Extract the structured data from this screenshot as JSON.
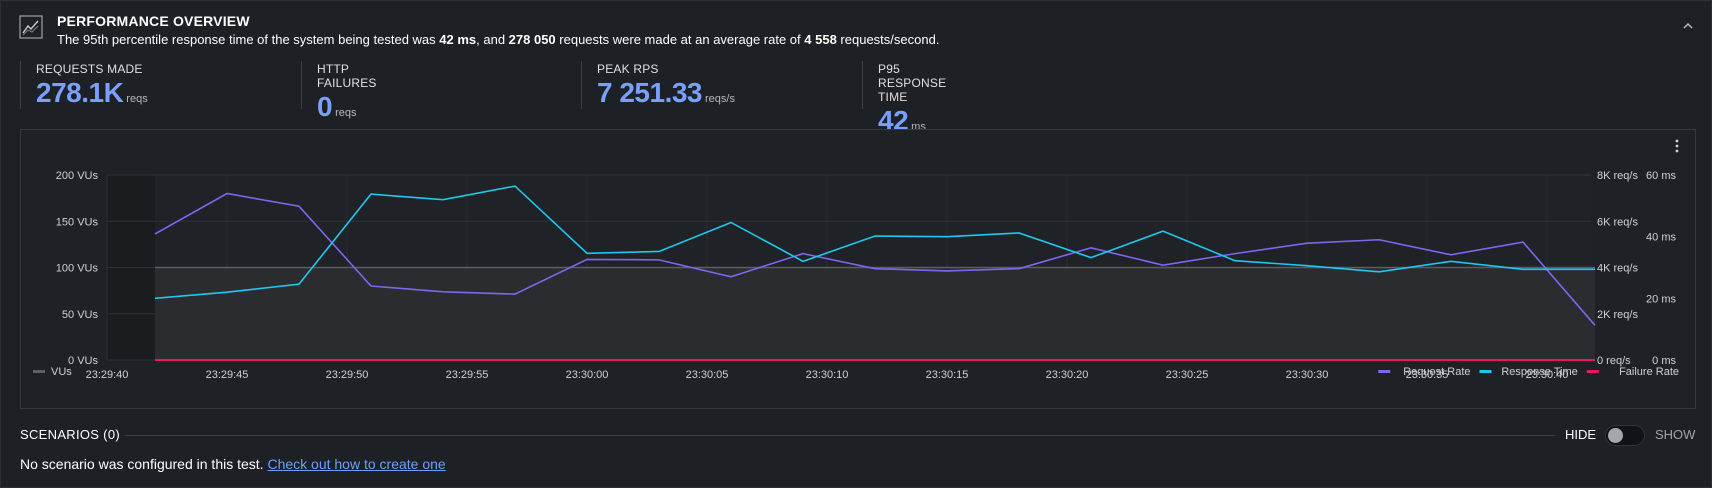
{
  "header": {
    "title": "PERFORMANCE OVERVIEW",
    "desc_1": "The 95th percentile response time of the system being tested was ",
    "desc_p95": "42 ms",
    "desc_2": ", and ",
    "desc_requests": "278 050",
    "desc_3": " requests were made at an average rate of ",
    "desc_rate": "4 558",
    "desc_4": " requests/second."
  },
  "stats": [
    {
      "label": "REQUESTS MADE",
      "value": "278.1K",
      "unit": "reqs"
    },
    {
      "label": "HTTP FAILURES",
      "value": "0",
      "unit": "reqs"
    },
    {
      "label": "PEAK RPS",
      "value": "7 251.33",
      "unit": "reqs/s"
    },
    {
      "label": "P95 RESPONSE TIME",
      "value": "42",
      "unit": "ms"
    }
  ],
  "chart_data": {
    "type": "line",
    "x_ticks": [
      "23:29:40",
      "23:29:45",
      "23:29:50",
      "23:29:55",
      "23:30:00",
      "23:30:05",
      "23:30:10",
      "23:30:15",
      "23:30:20",
      "23:30:25",
      "23:30:30",
      "23:30:35",
      "23:30:40"
    ],
    "y_left_ticks": [
      "0 VUs",
      "50 VUs",
      "100 VUs",
      "150 VUs",
      "200 VUs"
    ],
    "y_left_lim": [
      0,
      200
    ],
    "y_right1_ticks": [
      "0 req/s",
      "2K req/s",
      "4K req/s",
      "6K req/s",
      "8K req/s"
    ],
    "y_right1_lim": [
      0,
      8000
    ],
    "y_right2_ticks": [
      "0 ms",
      "20 ms",
      "40 ms",
      "60 ms"
    ],
    "y_right2_lim": [
      0,
      60
    ],
    "x_times": [
      "23:29:42",
      "23:29:45",
      "23:29:48",
      "23:29:51",
      "23:29:54",
      "23:29:57",
      "23:30:00",
      "23:30:03",
      "23:30:06",
      "23:30:09",
      "23:30:12",
      "23:30:15",
      "23:30:18",
      "23:30:21",
      "23:30:24",
      "23:30:27",
      "23:30:30",
      "23:30:33",
      "23:30:36",
      "23:30:39",
      "23:30:42"
    ],
    "grid": true,
    "legend_left": [
      {
        "name": "VUs",
        "color": "#5c5f63"
      }
    ],
    "legend_right": [
      {
        "name": "Request Rate",
        "color": "#7b68ee"
      },
      {
        "name": "Response Time",
        "color": "#1ec8ef"
      },
      {
        "name": "Failure Rate",
        "color": "#e8185a"
      }
    ],
    "series": [
      {
        "name": "VUs",
        "axis": "left",
        "values": [
          100,
          100,
          100,
          100,
          100,
          100,
          100,
          100,
          100,
          100,
          100,
          100,
          100,
          100,
          100,
          100,
          100,
          100,
          100,
          100,
          100
        ]
      },
      {
        "name": "Request Rate",
        "axis": "right1",
        "values": [
          5450,
          7200,
          6650,
          3200,
          2950,
          2850,
          4350,
          4330,
          3600,
          4600,
          3950,
          3850,
          3950,
          4850,
          4100,
          4600,
          5050,
          5200,
          4550,
          5100,
          1500
        ]
      },
      {
        "name": "Response Time",
        "axis": "right2",
        "values": [
          20,
          22,
          24.6,
          53.8,
          52,
          56.4,
          34.6,
          35.2,
          44.6,
          32,
          40.2,
          40,
          41.2,
          33.2,
          41.8,
          32.2,
          30.6,
          28.6,
          32,
          29.4,
          29.4
        ]
      },
      {
        "name": "Failure Rate",
        "axis": "right1",
        "values": [
          0,
          0,
          0,
          0,
          0,
          0,
          0,
          0,
          0,
          0,
          0,
          0,
          0,
          0,
          0,
          0,
          0,
          0,
          0,
          0,
          0
        ]
      }
    ]
  },
  "scenarios": {
    "title": "SCENARIOS (0)",
    "hide": "HIDE",
    "show": "SHOW",
    "text": "No scenario was configured in this test. ",
    "link": "Check out how to create one"
  }
}
